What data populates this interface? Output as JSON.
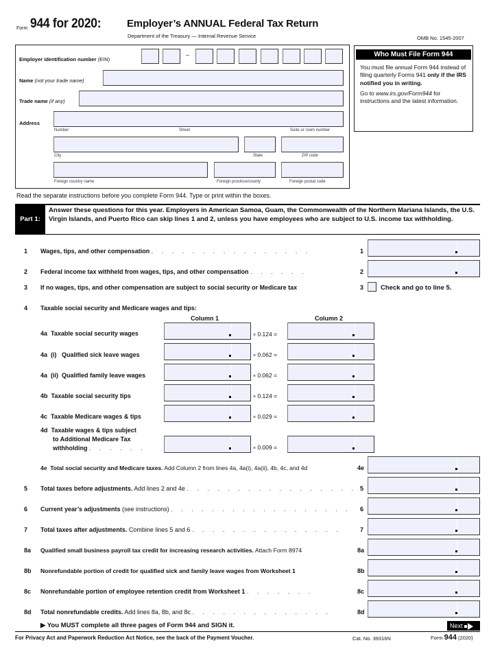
{
  "header": {
    "form_word": "Form",
    "form_number": "944 for 2020:",
    "title": "Employer’s ANNUAL Federal Tax Return",
    "department": "Department of the Treasury — Internal Revenue Service",
    "omb": "OMB No. 1545-2007"
  },
  "employer": {
    "ein_label": "Employer identification number",
    "ein_label_suffix": "(EIN)",
    "ein_separator": "–",
    "name_label": "Name",
    "name_hint": "(not your trade name)",
    "trade_label": "Trade name",
    "trade_hint": "(if any)",
    "address_label": "Address",
    "sublabels": {
      "number": "Number",
      "street": "Street",
      "suite": "Suite or room number",
      "city": "City",
      "state": "State",
      "zip": "ZIP code",
      "foreign_country": "Foreign country name",
      "foreign_province": "Foreign province/county",
      "foreign_postal": "Foreign postal code"
    },
    "values": {
      "ein": "",
      "name": "",
      "trade_name": "",
      "address": "",
      "city": "",
      "state": "",
      "zip": "",
      "foreign_country": "",
      "foreign_province": "",
      "foreign_postal": ""
    }
  },
  "who_must_file": {
    "heading": "Who Must File Form 944",
    "p1_normal": "You must file annual Form 944 instead of filing quarterly Forms 941 ",
    "p1_bold": "only if the IRS notified you in writing.",
    "p2_pre": "Go to ",
    "p2_link": "www.irs.gov/Form944",
    "p2_post": " for instructions and the latest information."
  },
  "read_instructions": "Read the separate instructions before you complete Form 944. Type or print within the boxes.",
  "part1": {
    "tag": "Part 1:",
    "text": "Answer these questions for this year. Employers in American Samoa, Guam, the Commonwealth of the Northern Mariana Islands, the U.S. Virgin Islands, and Puerto Rico can skip lines 1 and 2, unless you have employees who are subject to U.S. income tax withholding."
  },
  "lines": {
    "l1": {
      "num": "1",
      "text": "Wages, tips, and other compensation",
      "ref": "1",
      "value": ""
    },
    "l2": {
      "num": "2",
      "text": "Federal income tax withheld from wages, tips, and other compensation",
      "ref": "2",
      "value": ""
    },
    "l3": {
      "num": "3",
      "text": "If no wages, tips, and other compensation are subject to social security or Medicare tax",
      "ref": "3",
      "check_label": "Check and go to line 5.",
      "checked": false
    },
    "l4": {
      "num": "4",
      "text": "Taxable social security and Medicare wages and tips:",
      "col1": "Column 1",
      "col2": "Column 2"
    },
    "l4rows": [
      {
        "code": "4a",
        "text": "Taxable social security wages",
        "rate": "0.124"
      },
      {
        "code": "4a  (i)",
        "text": "Qualified sick leave wages",
        "rate": "0.062"
      },
      {
        "code": "4a  (ii)",
        "text": "Qualified family leave wages",
        "rate": "0.062"
      },
      {
        "code": "4b",
        "text": "Taxable social security tips",
        "rate": "0.124"
      },
      {
        "code": "4c",
        "text": "Taxable Medicare wages & tips",
        "rate": "0.029"
      },
      {
        "code": "4d",
        "text": "Taxable wages & tips subject to Additional Medicare Tax withholding",
        "text_l1": "Taxable wages & tips subject",
        "text_l2": "to Additional Medicare Tax",
        "text_l3": "withholding",
        "rate": "0.009"
      }
    ],
    "mult_sign": "×",
    "eq_sign": "=",
    "l4e": {
      "code": "4e",
      "bold": "Total social security and Medicare taxes.",
      "normal": " Add Column 2 from lines 4a, 4a(i), 4a(ii), 4b, 4c, and 4d",
      "ref": "4e",
      "value": ""
    },
    "l5": {
      "num": "5",
      "bold": "Total taxes before adjustments.",
      "normal": " Add lines 2 and 4e",
      "ref": "5",
      "value": ""
    },
    "l6": {
      "num": "6",
      "bold": "Current year’s adjustments",
      "normal": " (see instructions)",
      "ref": "6",
      "value": ""
    },
    "l7": {
      "num": "7",
      "bold": "Total taxes after adjustments.",
      "normal": " Combine lines 5 and 6",
      "ref": "7",
      "value": ""
    },
    "l8a": {
      "num": "8a",
      "bold": "Qualified small business payroll tax credit for increasing research activities.",
      "normal": " Attach Form 8974",
      "ref": "8a",
      "value": ""
    },
    "l8b": {
      "num": "8b",
      "bold": "Nonrefundable portion of credit for qualified sick and family leave wages from Worksheet 1",
      "normal": "",
      "ref": "8b",
      "value": ""
    },
    "l8c": {
      "num": "8c",
      "bold": "Nonrefundable portion of employee retention credit from Worksheet 1",
      "normal": "",
      "ref": "8c",
      "value": ""
    },
    "l8d": {
      "num": "8d",
      "bold": "Total nonrefundable credits.",
      "normal": " Add lines 8a, 8b, and 8c",
      "ref": "8d",
      "value": ""
    }
  },
  "must_complete": "▶ You MUST complete all three pages of Form 944 and SIGN it.",
  "next_label": "Next",
  "footer": {
    "privacy": "For Privacy Act and Paperwork Reduction Act Notice, see the back of the Payment Voucher.",
    "cat_no": "Cat. No. 39316N",
    "form_word": "Form",
    "form_num": "944",
    "year": "(2020)"
  }
}
